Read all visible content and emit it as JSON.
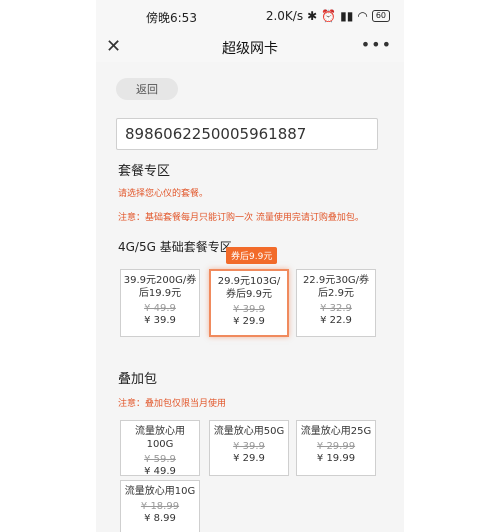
{
  "status_bar": {
    "time": "傍晚6:53",
    "net_speed": "2.0K/s",
    "battery": "60"
  },
  "header": {
    "title": "超级网卡"
  },
  "back_button": "返回",
  "card_number": "8986062250005961887",
  "package_section": {
    "title": "套餐专区",
    "hint": "请选择您心仪的套餐。",
    "notice": "注意：基础套餐每月只能订购一次 流量使用完请订购叠加包。"
  },
  "basic_section": {
    "title": "4G/5G 基础套餐专区",
    "badge": "券后9.9元",
    "packages": [
      {
        "name": "39.9元200G/券后19.9元",
        "original": "¥ 49.9",
        "price": "¥ 39.9",
        "selected": false
      },
      {
        "name": "29.9元103G/券后9.9元",
        "original": "¥ 39.9",
        "price": "¥ 29.9",
        "selected": true
      },
      {
        "name": "22.9元30G/券后2.9元",
        "original": "¥ 32.9",
        "price": "¥ 22.9",
        "selected": false
      }
    ]
  },
  "addon_section": {
    "title": "叠加包",
    "notice": "注意：叠加包仅限当月使用",
    "packages": [
      {
        "name": "流量放心用100G",
        "original": "¥ 59.9",
        "price": "¥ 49.9"
      },
      {
        "name": "流量放心用50G",
        "original": "¥ 39.9",
        "price": "¥ 29.9"
      },
      {
        "name": "流量放心用25G",
        "original": "¥ 29.99",
        "price": "¥ 19.99"
      },
      {
        "name": "流量放心用10G",
        "original": "¥ 18.99",
        "price": "¥ 8.99"
      }
    ]
  },
  "colors": {
    "accent": "#f26b2a",
    "notice": "#e2572b"
  }
}
